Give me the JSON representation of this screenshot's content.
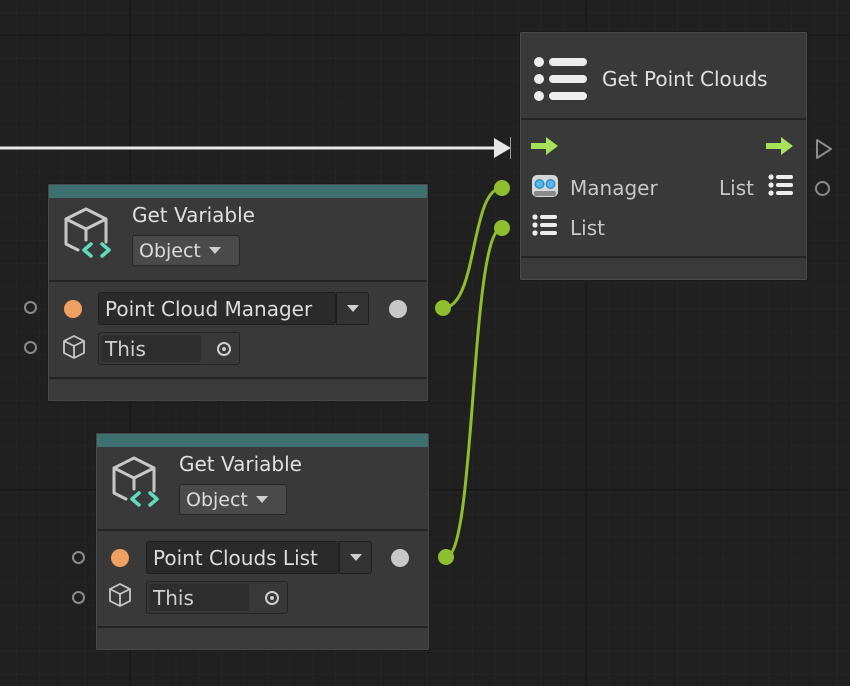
{
  "graph": {
    "flow_wire_color": "#e8e8e8",
    "value_wire_color": "#8dbf2e",
    "nodes": {
      "get_point_clouds": {
        "title": "Get Point Clouds",
        "icon": "list-icon",
        "inputs": [
          {
            "type": "control",
            "icon": "flow-arrow-icon"
          },
          {
            "type": "value",
            "label": "Manager",
            "icon": "vr-headset-icon"
          },
          {
            "type": "value",
            "label": "List",
            "icon": "list-icon"
          }
        ],
        "outputs": [
          {
            "type": "control",
            "icon": "flow-arrow-icon"
          },
          {
            "type": "value",
            "label": "List",
            "icon": "list-icon"
          }
        ]
      },
      "get_variable_1": {
        "title": "Get Variable",
        "kind_dropdown": "Object",
        "variable_name": "Point Cloud Manager",
        "target": "This",
        "header_color": "#3d7070"
      },
      "get_variable_2": {
        "title": "Get Variable",
        "kind_dropdown": "Object",
        "variable_name": "Point Clouds List",
        "target": "This",
        "header_color": "#3d7070"
      }
    },
    "colors": {
      "accent_green": "#a4e35a",
      "port_orange": "#f0a060",
      "port_grey": "#c8c8c8",
      "node_bg": "#393939",
      "canvas_bg": "#202020"
    }
  }
}
